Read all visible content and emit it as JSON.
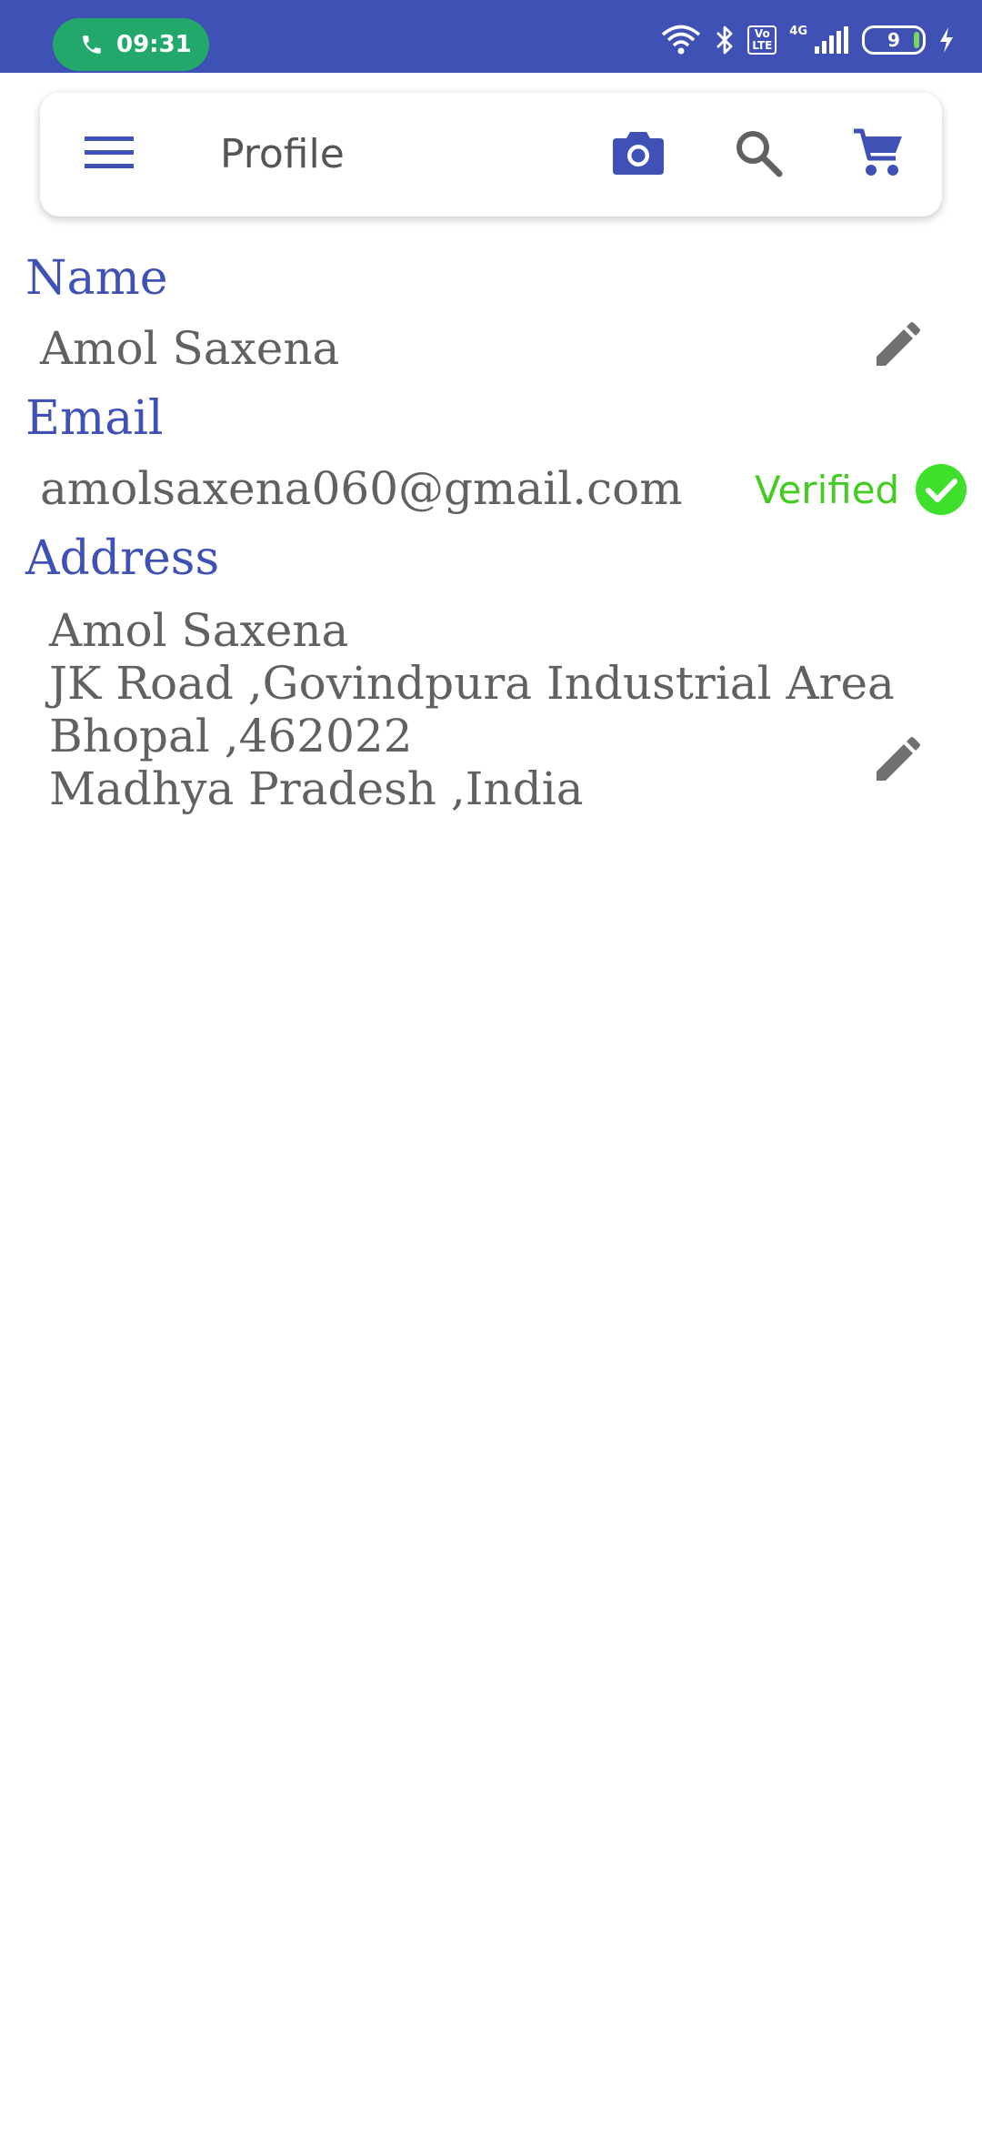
{
  "status_bar": {
    "time": "09:31",
    "network": "4G",
    "volte": "Vo LTE",
    "battery": "9"
  },
  "app_bar": {
    "title": "Profile",
    "icons": [
      "menu-icon",
      "camera-icon",
      "search-icon",
      "cart-icon"
    ]
  },
  "profile": {
    "name_label": "Name",
    "name_value": "Amol Saxena",
    "email_label": "Email",
    "email_value": "amolsaxena060@gmail.com",
    "verified_text": "Verified",
    "address_label": "Address",
    "address_lines": [
      "Amol Saxena",
      "JK Road ,Govindpura Industrial Area",
      "Bhopal ,462022",
      "Madhya Pradesh ,India"
    ]
  },
  "colors": {
    "primary": "#3f51b5",
    "text_gray": "#616161",
    "verified_green": "#44cc22",
    "call_pill": "#21a86a"
  }
}
